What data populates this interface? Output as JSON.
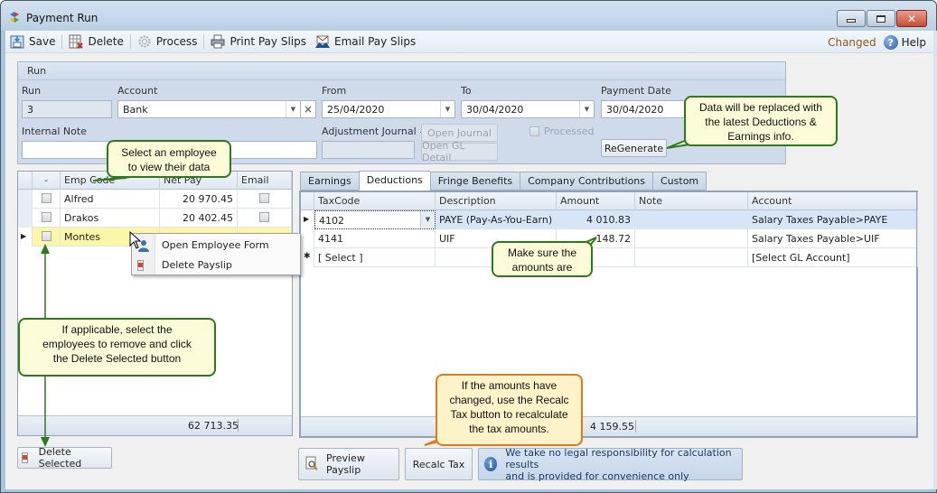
{
  "window": {
    "title": "Payment Run",
    "controls": {
      "minimize": "minimize",
      "maximize": "maximize",
      "close": "✕"
    }
  },
  "toolbar": {
    "items": [
      {
        "label": "Save",
        "icon": "save-icon"
      },
      {
        "label": "Delete",
        "icon": "delete-grid-icon"
      },
      {
        "label": "Process",
        "icon": "gear-icon"
      },
      {
        "label": "Print Pay Slips",
        "icon": "printer-icon"
      },
      {
        "label": "Email Pay Slips",
        "icon": "email-icon"
      }
    ],
    "status": "Changed",
    "help": "Help"
  },
  "run": {
    "group_title": "Run",
    "run_label": "Run",
    "run_value": "3",
    "account_label": "Account",
    "account_value": "Bank",
    "from_label": "From",
    "from_value": "25/04/2020",
    "to_label": "To",
    "to_value": "30/04/2020",
    "payment_date_label": "Payment Date",
    "payment_date_value": "30/04/2020",
    "internal_note_label": "Internal Note",
    "internal_note_value": "",
    "adjustment_journal_label": "Adjustment Journal #",
    "adjustment_journal_value": "",
    "open_journal": "Open Journal",
    "open_gl_detail": "Open GL Detail",
    "processed_label": "Processed",
    "processed_checked": false,
    "regenerate": "ReGenerate"
  },
  "employees": {
    "columns": [
      "-",
      "Emp Code",
      "Net Pay",
      "Email"
    ],
    "rows": [
      {
        "code": "Alfred",
        "net_pay": "20 970.45",
        "selected": false,
        "email": false
      },
      {
        "code": "Drakos",
        "net_pay": "20 402.45",
        "selected": false,
        "email": false
      },
      {
        "code": "Montes",
        "net_pay": "",
        "selected": false,
        "email": false,
        "current": true
      }
    ],
    "total": "62 713.35",
    "delete_selected": "Delete Selected"
  },
  "context_menu": {
    "items": [
      {
        "label": "Open Employee Form",
        "icon": "employee-icon"
      },
      {
        "label": "Delete Payslip",
        "icon": "delete-payslip-icon"
      }
    ]
  },
  "tabs": [
    {
      "label": "Earnings",
      "active": false
    },
    {
      "label": "Deductions",
      "active": true
    },
    {
      "label": "Fringe Benefits",
      "active": false
    },
    {
      "label": "Company Contributions",
      "active": false
    },
    {
      "label": "Custom",
      "active": false
    }
  ],
  "deductions": {
    "columns": [
      "TaxCode",
      "Description",
      "Amount",
      "Note",
      "Account"
    ],
    "rows": [
      {
        "tax_code": "4102",
        "description": "PAYE (Pay-As-You-Earn)",
        "amount": "4 010.83",
        "note": "",
        "account": "Salary Taxes Payable>PAYE",
        "current": true
      },
      {
        "tax_code": "4141",
        "description": "UIF",
        "amount": "148.72",
        "note": "",
        "account": "Salary Taxes Payable>UIF"
      },
      {
        "tax_code": "[ Select ]",
        "description": "",
        "amount": "",
        "note": "",
        "account": "[Select GL Account]",
        "new_row": true
      }
    ],
    "total": "4 159.55"
  },
  "bottom": {
    "preview_payslip": "Preview Payslip",
    "recalc_tax": "Recalc Tax",
    "disclaimer_line1": "We take no legal responsibility for calculation results",
    "disclaimer_line2": "and is provided for convenience only"
  },
  "callouts": {
    "select_employee": [
      "Select an employee",
      "to view their data"
    ],
    "regenerate": [
      "Data will be replaced with",
      "the latest Deductions &",
      "Earnings info."
    ],
    "amounts": [
      "Make sure the",
      "amounts are"
    ],
    "delete_selected": [
      "If applicable, select the",
      "employees to remove and click",
      "the Delete Selected button"
    ],
    "recalc": [
      "If the amounts have",
      "changed, use the Recalc",
      "Tax button to recalculate",
      "the tax amounts."
    ]
  },
  "colors": {
    "callout_border": "#2d7a1e",
    "callout_fill": "#fcfcd8",
    "recalc_callout_border": "#e07a1e",
    "selected_row": "#fbf7a8",
    "current_row": "#d7e6f7",
    "status_changed": "#8a5a1c"
  }
}
